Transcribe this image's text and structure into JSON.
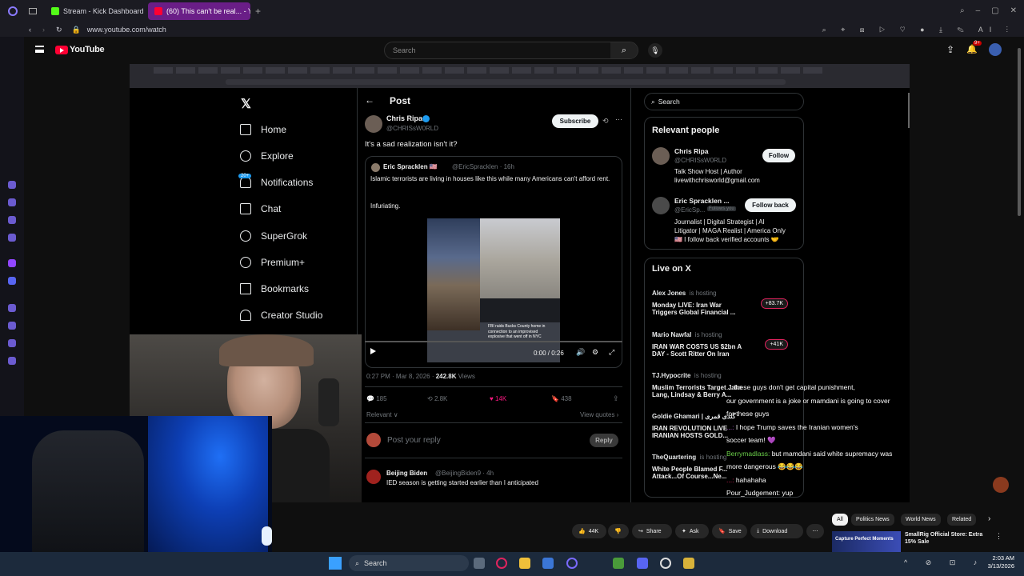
{
  "browser": {
    "tabs": [
      {
        "label": "Stream - Kick Dashboard",
        "color": "#53fc18"
      },
      {
        "label": "(60) This can't be real... - Y",
        "color": "#ff0033"
      }
    ],
    "url": "www.youtube.com/watch"
  },
  "youtube": {
    "logo": "YouTube",
    "search_placeholder": "Search",
    "notif_badge": "9+",
    "actions": {
      "likes": "44K",
      "share": "Share",
      "ask": "Ask",
      "save": "Save",
      "download": "Download"
    },
    "chips": [
      "All",
      "Politics News",
      "World News",
      "Related"
    ],
    "rec": {
      "title": "SmallRig Official Store: Extra 15% Sale",
      "thumb_text": "Capture Perfect Moments"
    }
  },
  "x": {
    "nav": [
      "Home",
      "Explore",
      "Notifications",
      "Chat",
      "SuperGrok",
      "Premium+",
      "Bookmarks",
      "Creator Studio"
    ],
    "notif_badge": "20+",
    "post_header": "Post",
    "search_placeholder": "Search",
    "post": {
      "author": "Chris Ripa",
      "handle": "@CHRISsW0RLD",
      "subscribe": "Subscribe",
      "text": "It's a sad realization isn't it?",
      "quote": {
        "author": "Eric Spracklen 🇺🇸",
        "handle": "@EricSpracklen · 16h",
        "text": "Islamic terrorists are living in houses like this while many Americans can't afford rent.",
        "text2": "Infuriating.",
        "caption": "FBI raids Bucks County home in connection to an improvised explosive that went off in NYC"
      },
      "time": "0:00 / 0:26",
      "meta": "0:27 PM · Mar 8, 2026 · ",
      "views": "242.8K",
      "views_label": " Views",
      "stats": {
        "replies": "185",
        "reposts": "2.8K",
        "likes": "14K",
        "bookmarks": "438"
      },
      "relevant": "Relevant ∨",
      "view_quotes": "View quotes ›",
      "reply_placeholder": "Post your reply",
      "reply_btn": "Reply",
      "reply": {
        "author": "Beijing Biden",
        "handle": "@BeijingBiden9 · 4h",
        "text": "IED season is getting started earlier than I anticipated"
      }
    },
    "relevant_people": {
      "title": "Relevant people",
      "people": [
        {
          "name": "Chris Ripa",
          "handle": "@CHRISsW0RLD",
          "btn": "Follow",
          "bio1": "Talk Show Host | Author",
          "bio2": "livewithchrisworld@gmail.com"
        },
        {
          "name": "Eric Spracklen ...",
          "handle": "@EricSp...",
          "follows": "Follows you",
          "btn": "Follow back",
          "bio1": "Journalist | Digital Strategist | AI",
          "bio2": "Litigator | MAGA Realist | America Only",
          "bio3": "🇺🇸 I follow back verified accounts 🤝"
        }
      ]
    },
    "live": {
      "title": "Live on X",
      "items": [
        {
          "host": "Alex Jones",
          "status": "is hosting",
          "title1": "Monday LIVE: Iran War",
          "title2": "Triggers Global Financial ...",
          "count": "+83.7K"
        },
        {
          "host": "Mario Nawfal",
          "status": "is hosting",
          "title1": "IRAN WAR COSTS US $2bn A",
          "title2": "DAY - Scott Ritter On Iran",
          "count": "+41K"
        },
        {
          "host": "TJ.Hypocrite",
          "status": "is hosting",
          "title1": "Muslim Terrorists Target Jake",
          "title2": "Lang, Lindsay & Berry A..."
        },
        {
          "host": "Goldie Ghamari | گلدی قمری",
          "status": "",
          "title1": "IRAN REVOLUTION LIVE",
          "title2": "IRANIAN HOSTS GOLD..."
        },
        {
          "host": "TheQuartering",
          "status": "is hosting",
          "title1": "White People Blamed F...",
          "title2": "Attack...Of Course...Ne..."
        }
      ]
    }
  },
  "chat": [
    {
      "user": "",
      "text": "... these guys don't get capital punishment,"
    },
    {
      "user": "",
      "text": "our government is a joke or mamdani is going to cover"
    },
    {
      "user": "",
      "text": "for these guys"
    },
    {
      "user": "...:",
      "text": "I hope Trump saves the Iranian women's",
      "ucolor": "#b05cd6"
    },
    {
      "user": "",
      "text": "soccer team! 💜"
    },
    {
      "user": "Berrymadlass:",
      "text": "but mamdani said white supremacy was",
      "ucolor": "#6bd04a"
    },
    {
      "user": "",
      "text": "more dangerous 😂😂😂"
    },
    {
      "user": "...:",
      "text": "hahahaha",
      "ucolor": "#e0245e"
    },
    {
      "user": "Pour_Judgement:",
      "text": "yup",
      "ucolor": "#ffffff"
    }
  ],
  "taskbar": {
    "search": "Search",
    "time": "2:03 AM",
    "date": "3/13/2026"
  },
  "colors": {
    "accent_purple": "#6a1e87",
    "x_blue": "#1d9bf0",
    "x_like": "#f91880"
  }
}
